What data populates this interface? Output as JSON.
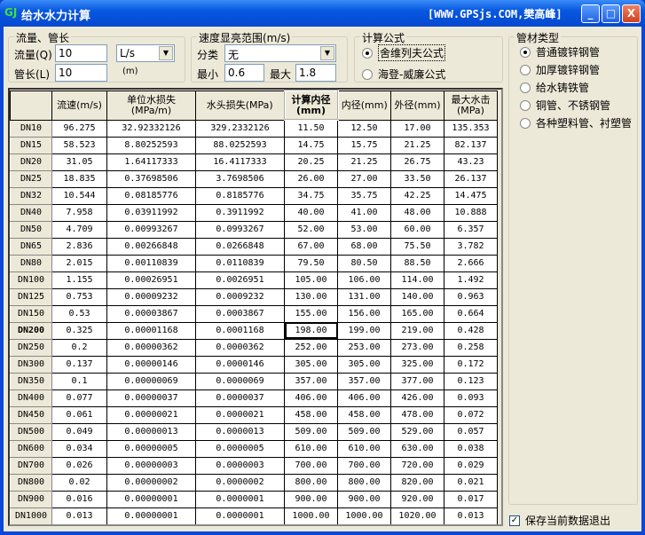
{
  "window": {
    "title": "给水水力计算",
    "logo": "GJ",
    "credit": "[WWW.GPSjs.COM,樊高峰]",
    "minimize": "_",
    "maximize": "□",
    "close": "X"
  },
  "flow_group": {
    "title": "流量、管长",
    "flow_label": "流量(Q)",
    "flow_value": "10",
    "unit_value": "L/s",
    "length_label": "管长(L)",
    "length_value": "10",
    "length_unit": "(m)"
  },
  "speed_group": {
    "title": "速度显亮范围(m/s)",
    "class_label": "分类",
    "class_value": "无",
    "min_label": "最小",
    "min_value": "0.6",
    "max_label": "最大",
    "max_value": "1.8"
  },
  "formula_group": {
    "title": "计算公式",
    "options": [
      {
        "label": "舍维列夫公式",
        "selected": true
      },
      {
        "label": "海登-威廉公式",
        "selected": false
      }
    ]
  },
  "material_group": {
    "title": "管材类型",
    "options": [
      {
        "label": "普通镀锌钢管",
        "selected": true
      },
      {
        "label": "加厚镀锌钢管",
        "selected": false
      },
      {
        "label": "给水铸铁管",
        "selected": false
      },
      {
        "label": "铜管、不锈钢管",
        "selected": false
      },
      {
        "label": "各种塑料管、衬塑管",
        "selected": false
      }
    ]
  },
  "save_checkbox": {
    "label": "保存当前数据退出",
    "checked": true
  },
  "table": {
    "headers": [
      "",
      "流速(m/s)",
      "单位水损失\n(MPa/m)",
      "水头损失(MPa)",
      "计算内径\n(mm)",
      "内径(mm)",
      "外径(mm)",
      "最大水击\n(MPa)"
    ],
    "selected_row": "DN200",
    "rows": [
      [
        "DN10",
        "96.275",
        "32.92332126",
        "329.2332126",
        "11.50",
        "12.50",
        "17.00",
        "135.353"
      ],
      [
        "DN15",
        "58.523",
        "8.80252593",
        "88.0252593",
        "14.75",
        "15.75",
        "21.25",
        "82.137"
      ],
      [
        "DN20",
        "31.05",
        "1.64117333",
        "16.4117333",
        "20.25",
        "21.25",
        "26.75",
        "43.23"
      ],
      [
        "DN25",
        "18.835",
        "0.37698506",
        "3.7698506",
        "26.00",
        "27.00",
        "33.50",
        "26.137"
      ],
      [
        "DN32",
        "10.544",
        "0.08185776",
        "0.8185776",
        "34.75",
        "35.75",
        "42.25",
        "14.475"
      ],
      [
        "DN40",
        "7.958",
        "0.03911992",
        "0.3911992",
        "40.00",
        "41.00",
        "48.00",
        "10.888"
      ],
      [
        "DN50",
        "4.709",
        "0.00993267",
        "0.0993267",
        "52.00",
        "53.00",
        "60.00",
        "6.357"
      ],
      [
        "DN65",
        "2.836",
        "0.00266848",
        "0.0266848",
        "67.00",
        "68.00",
        "75.50",
        "3.782"
      ],
      [
        "DN80",
        "2.015",
        "0.00110839",
        "0.0110839",
        "79.50",
        "80.50",
        "88.50",
        "2.666"
      ],
      [
        "DN100",
        "1.155",
        "0.00026951",
        "0.0026951",
        "105.00",
        "106.00",
        "114.00",
        "1.492"
      ],
      [
        "DN125",
        "0.753",
        "0.00009232",
        "0.0009232",
        "130.00",
        "131.00",
        "140.00",
        "0.963"
      ],
      [
        "DN150",
        "0.53",
        "0.00003867",
        "0.0003867",
        "155.00",
        "156.00",
        "165.00",
        "0.664"
      ],
      [
        "DN200",
        "0.325",
        "0.00001168",
        "0.0001168",
        "198.00",
        "199.00",
        "219.00",
        "0.428"
      ],
      [
        "DN250",
        "0.2",
        "0.00000362",
        "0.0000362",
        "252.00",
        "253.00",
        "273.00",
        "0.258"
      ],
      [
        "DN300",
        "0.137",
        "0.00000146",
        "0.0000146",
        "305.00",
        "305.00",
        "325.00",
        "0.172"
      ],
      [
        "DN350",
        "0.1",
        "0.00000069",
        "0.0000069",
        "357.00",
        "357.00",
        "377.00",
        "0.123"
      ],
      [
        "DN400",
        "0.077",
        "0.00000037",
        "0.0000037",
        "406.00",
        "406.00",
        "426.00",
        "0.093"
      ],
      [
        "DN450",
        "0.061",
        "0.00000021",
        "0.0000021",
        "458.00",
        "458.00",
        "478.00",
        "0.072"
      ],
      [
        "DN500",
        "0.049",
        "0.00000013",
        "0.0000013",
        "509.00",
        "509.00",
        "529.00",
        "0.057"
      ],
      [
        "DN600",
        "0.034",
        "0.00000005",
        "0.0000005",
        "610.00",
        "610.00",
        "630.00",
        "0.038"
      ],
      [
        "DN700",
        "0.026",
        "0.00000003",
        "0.0000003",
        "700.00",
        "700.00",
        "720.00",
        "0.029"
      ],
      [
        "DN800",
        "0.02",
        "0.00000002",
        "0.0000002",
        "800.00",
        "800.00",
        "820.00",
        "0.021"
      ],
      [
        "DN900",
        "0.016",
        "0.00000001",
        "0.0000001",
        "900.00",
        "900.00",
        "920.00",
        "0.017"
      ],
      [
        "DN1000",
        "0.013",
        "0.00000001",
        "0.0000001",
        "1000.00",
        "1000.00",
        "1020.00",
        "0.013"
      ]
    ]
  }
}
